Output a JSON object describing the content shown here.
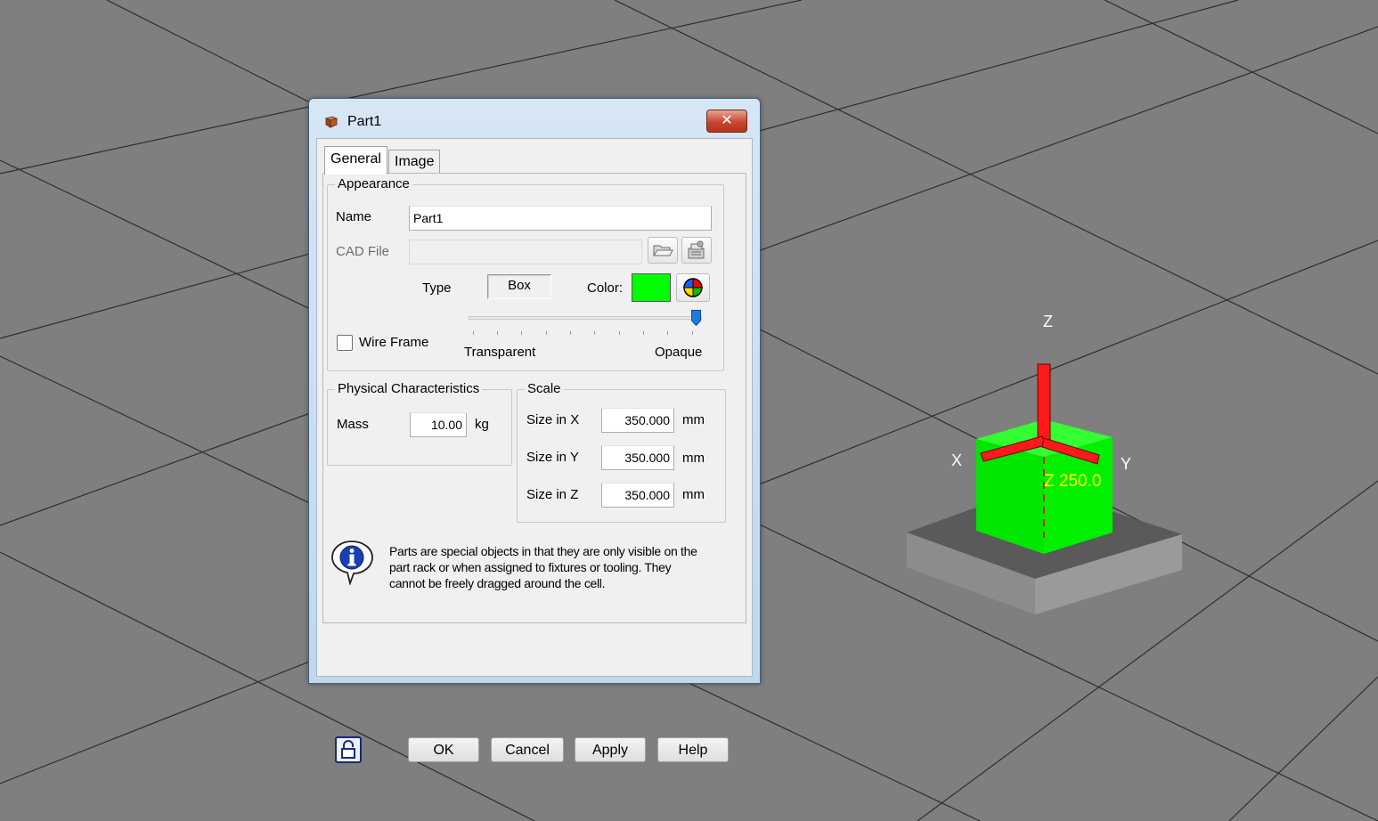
{
  "viewport": {
    "axis_labels": {
      "z": "Z",
      "x": "X",
      "y": "Y"
    },
    "measure_label": "Z 250.0",
    "colors": {
      "background": "#7f7f7f",
      "part": "#00ff00",
      "axis": "#ff0000",
      "measure": "#ffff00"
    }
  },
  "dialog": {
    "title": "Part1",
    "close_glyph": "✕",
    "tabs": [
      {
        "label": "General",
        "selected": true
      },
      {
        "label": "Image",
        "selected": false
      }
    ],
    "appearance": {
      "group_title": "Appearance",
      "name_label": "Name",
      "name_value": "Part1",
      "cad_file_label": "CAD File",
      "cad_file_value": "",
      "type_label": "Type",
      "type_value": "Box",
      "color_label": "Color:",
      "color_value": "#00ff00",
      "wireframe_label": "Wire Frame",
      "wireframe_checked": false,
      "slider_min_label": "Transparent",
      "slider_max_label": "Opaque",
      "opacity_percent": 100
    },
    "physical": {
      "group_title": "Physical Characteristics",
      "mass_label": "Mass",
      "mass_value": "10.00",
      "mass_unit": "kg"
    },
    "scale": {
      "group_title": "Scale",
      "rows": [
        {
          "label": "Size in X",
          "value": "350.000",
          "unit": "mm"
        },
        {
          "label": "Size in Y",
          "value": "350.000",
          "unit": "mm"
        },
        {
          "label": "Size in Z",
          "value": "350.000",
          "unit": "mm"
        }
      ]
    },
    "info_text": "Parts are special objects in that they are only visible on the part rack or when assigned to fixtures or tooling.  They cannot be freely dragged around the cell.",
    "buttons": {
      "ok": "OK",
      "cancel": "Cancel",
      "apply": "Apply",
      "help": "Help"
    }
  }
}
